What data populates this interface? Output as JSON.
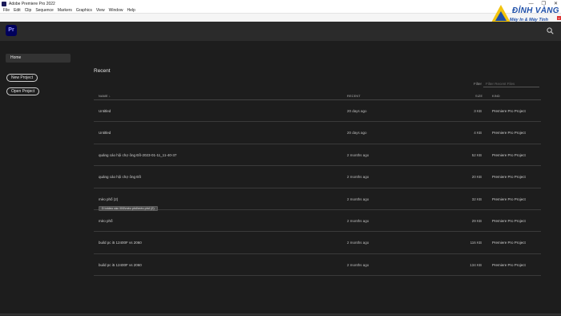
{
  "window": {
    "title": "Adobe Premiere Pro 2022",
    "controls": [
      "—",
      "❐",
      "✕"
    ]
  },
  "menu": [
    "File",
    "Edit",
    "Clip",
    "Sequence",
    "Markers",
    "Graphics",
    "View",
    "Window",
    "Help"
  ],
  "watermark": {
    "brand": "ĐỈNH VÀNG",
    "tagline": "Máy In & Máy Tính",
    "close": "x"
  },
  "header": {
    "logo": "Pr",
    "search_icon": "search-icon"
  },
  "sidebar": {
    "home_label": "Home",
    "new_project_label": "New Project",
    "open_project_label": "Open Project"
  },
  "main": {
    "title": "Recent",
    "filter_label": "Filter",
    "filter_placeholder": "Filter Recent Files",
    "columns": {
      "name": "NAME ↓",
      "recent": "RECENT",
      "size": "SIZE",
      "kind": "KIND"
    },
    "rows": [
      {
        "name": "Untitled",
        "recent": "20 days ago",
        "size": "3 KB",
        "kind": "Premiere Pro Project"
      },
      {
        "name": "Untitled",
        "recent": "20 days ago",
        "size": "4 KB",
        "kind": "Premiere Pro Project"
      },
      {
        "name": "quảng cáo hội chợ ông Đồ-2023-01-11_11-40-37",
        "recent": "2 months ago",
        "size": "52 KB",
        "kind": "Premiere Pro Project"
      },
      {
        "name": "quảng cáo hội chợ ông Đồ",
        "recent": "2 months ago",
        "size": "20 KB",
        "kind": "Premiere Pro Project"
      },
      {
        "name": "mèo phố (2)",
        "recent": "2 months ago",
        "size": "32 KB",
        "kind": "Premiere Pro Project"
      },
      {
        "name": "mèo phố",
        "recent": "2 months ago",
        "size": "29 KB",
        "kind": "Premiere Pro Project"
      },
      {
        "name": "build pc i5 12400F vs 2060",
        "recent": "2 months ago",
        "size": "116 KB",
        "kind": "Premiere Pro Project"
      },
      {
        "name": "build pc i5 12400F vs 2060",
        "recent": "2 months ago",
        "size": "134 KB",
        "kind": "Premiere Pro Project"
      }
    ],
    "tooltip": "D:\\video các \\0\\0\\​mèo phố\\mèo phố (2)"
  }
}
